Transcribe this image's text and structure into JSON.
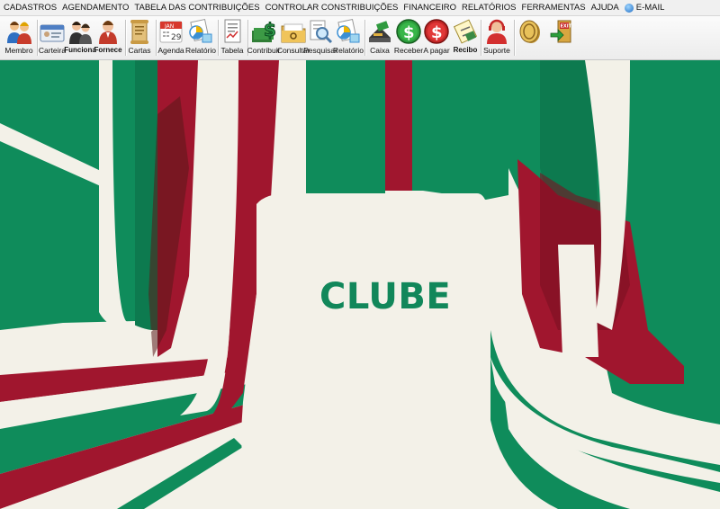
{
  "menu": [
    "CADASTROS",
    "AGENDAMENTO",
    "TABELA DAS CONTRIBUIÇÕES",
    "CONTROLAR CONSTRIBUIÇÕES",
    "FINANCEIRO",
    "RELATÓRIOS",
    "FERRAMENTAS",
    "AJUDA",
    "E-MAIL"
  ],
  "toolbar": {
    "membro": "Membro",
    "carteira": "Carteira",
    "funciona": "Funciona",
    "fornece": "Fornece",
    "cartas": "Cartas",
    "agenda": "Agenda",
    "agenda_icon_top": "JAN",
    "agenda_icon_day": "29",
    "relatorio1": "Relatório",
    "tabela": "Tabela",
    "contribuir": "Contribuir",
    "consultar": "Consultar",
    "pesquisar": "Pesquisar",
    "relatorio2": "Relatório",
    "caixa": "Caixa",
    "receber": "Receber",
    "apagar": "A pagar",
    "recibo": "Recibo",
    "suporte": "Suporte",
    "exit_icon_text": "EXIT"
  },
  "brand": "CLUBE",
  "colors": {
    "green": "#0f8c5b",
    "dark_green": "#0d6b45",
    "red": "#a0162e",
    "cream": "#f3f1e8"
  }
}
